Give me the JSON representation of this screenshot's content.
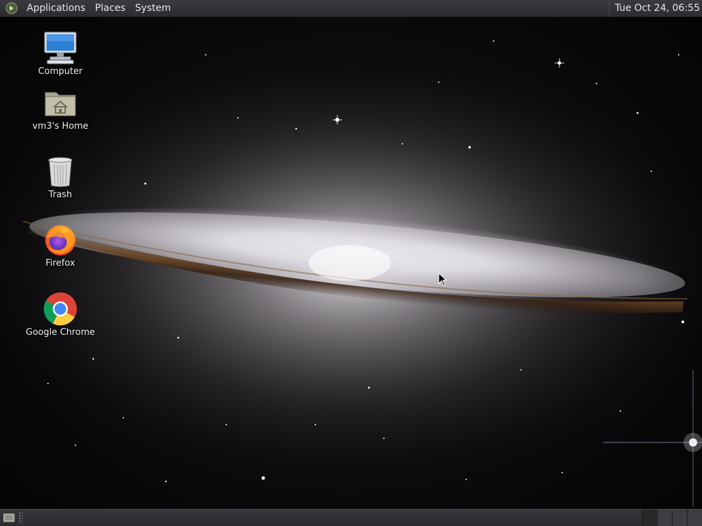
{
  "top_panel": {
    "menus": [
      "Applications",
      "Places",
      "System"
    ],
    "clock": "Tue Oct 24, 06:55",
    "logo_icon": "distro-logo-icon"
  },
  "desktop": {
    "wallpaper": "sombrero-galaxy",
    "icons": [
      {
        "label": "Computer",
        "icon": "computer-icon"
      },
      {
        "label": "vm3's Home",
        "icon": "home-folder-icon"
      },
      {
        "label": "Trash",
        "icon": "trash-icon"
      },
      {
        "label": "Firefox",
        "icon": "firefox-icon"
      },
      {
        "label": "Google Chrome",
        "icon": "chrome-icon"
      }
    ]
  },
  "bottom_panel": {
    "show_desktop_icon": "show-desktop-icon",
    "workspace_count": 4,
    "active_workspace": 1
  },
  "colors": {
    "panel": "#2f3033",
    "panel_text": "#e8e8e8"
  }
}
